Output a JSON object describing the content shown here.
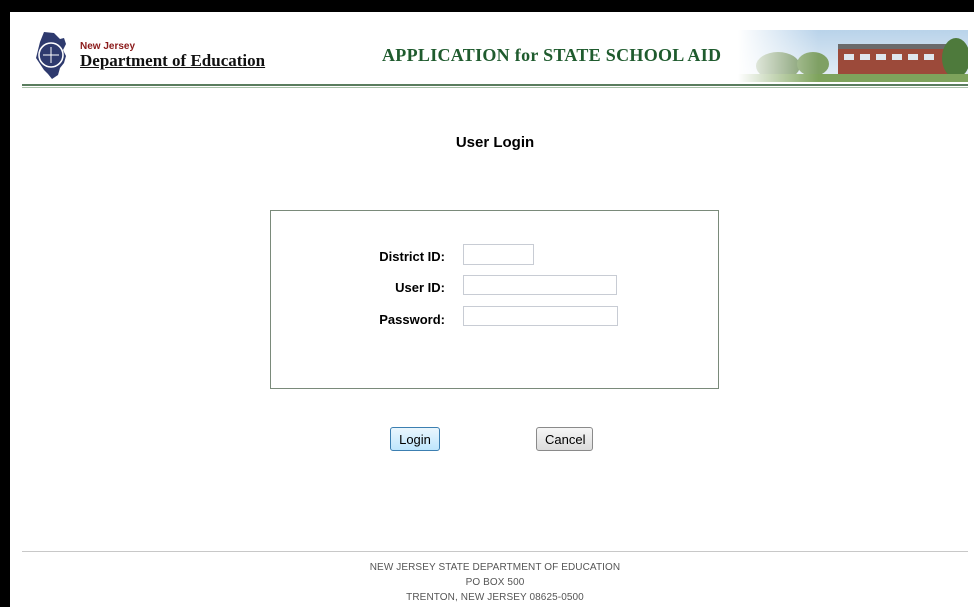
{
  "header": {
    "logo_small_text": "New Jersey",
    "logo_big_text": "Department of Education",
    "app_title": "APPLICATION for STATE SCHOOL AID"
  },
  "page": {
    "title": "User Login"
  },
  "form": {
    "district_label": "District ID:",
    "district_value": "",
    "user_label": "User ID:",
    "user_value": "",
    "password_label": "Password:",
    "password_value": ""
  },
  "buttons": {
    "login": "Login",
    "cancel": "Cancel"
  },
  "footer": {
    "line1": "NEW JERSEY STATE DEPARTMENT OF EDUCATION",
    "line2": "PO BOX 500",
    "line3": "TRENTON, NEW JERSEY 08625-0500"
  },
  "colors": {
    "app_title": "#1f5b2e",
    "logo_small": "#8b1a1a",
    "header_rule": "#5a7d5e",
    "primary_button": "#bee6fd"
  }
}
